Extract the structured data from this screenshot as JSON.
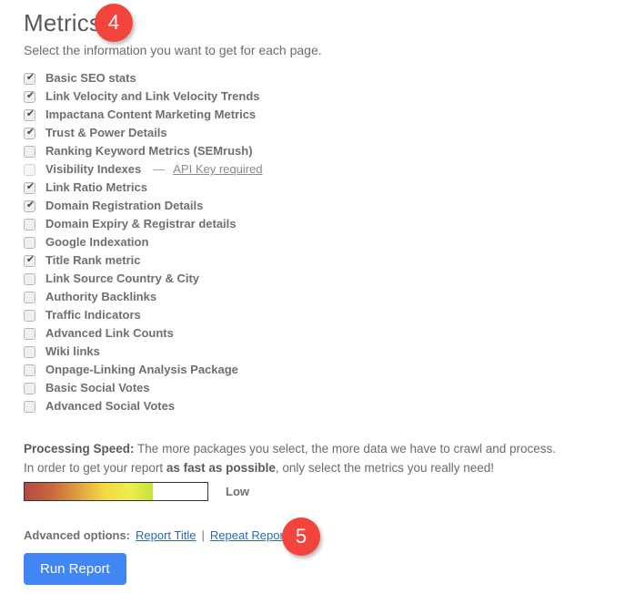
{
  "header": {
    "title": "Metrics",
    "step_badge": "4",
    "subtitle": "Select the information you want to get for each page."
  },
  "metrics": {
    "items": [
      {
        "label": "Basic SEO stats",
        "checked": true,
        "disabled": false
      },
      {
        "label": "Link Velocity and Link Velocity Trends",
        "checked": true,
        "disabled": false
      },
      {
        "label": "Impactana Content Marketing Metrics",
        "checked": true,
        "disabled": false
      },
      {
        "label": "Trust & Power Details",
        "checked": true,
        "disabled": false
      },
      {
        "label": "Ranking Keyword Metrics (SEMrush)",
        "checked": false,
        "disabled": false
      },
      {
        "label": "Visibility Indexes",
        "checked": false,
        "disabled": true,
        "note_dash": "—",
        "note_link": "API Key required"
      },
      {
        "label": "Link Ratio Metrics",
        "checked": true,
        "disabled": false
      },
      {
        "label": "Domain Registration Details",
        "checked": true,
        "disabled": false
      },
      {
        "label": "Domain Expiry & Registrar details",
        "checked": false,
        "disabled": false
      },
      {
        "label": "Google Indexation",
        "checked": false,
        "disabled": false
      },
      {
        "label": "Title Rank metric",
        "checked": true,
        "disabled": false
      },
      {
        "label": "Link Source Country & City",
        "checked": false,
        "disabled": false
      },
      {
        "label": "Authority Backlinks",
        "checked": false,
        "disabled": false
      },
      {
        "label": "Traffic Indicators",
        "checked": false,
        "disabled": false
      },
      {
        "label": "Advanced Link Counts",
        "checked": false,
        "disabled": false
      },
      {
        "label": "Wiki links",
        "checked": false,
        "disabled": false
      },
      {
        "label": "Onpage-Linking Analysis Package",
        "checked": false,
        "disabled": false
      },
      {
        "label": "Basic Social Votes",
        "checked": false,
        "disabled": false
      },
      {
        "label": "Advanced Social Votes",
        "checked": false,
        "disabled": false
      }
    ]
  },
  "processing_speed": {
    "line1_bold": "Processing Speed:",
    "line1_rest": " The more packages you select, the more data we have to crawl and process.",
    "line2_pre": "In order to get your report ",
    "line2_bold": "as fast as possible",
    "line2_post": ", only select the metrics you really need!",
    "gauge_fill_percent": "70%",
    "gauge_level_label": "Low",
    "gauge_colors": [
      "#b54a43",
      "#c9693f",
      "#e0a040",
      "#f4d845",
      "#eded4c",
      "#c8e33c"
    ]
  },
  "advanced": {
    "label": "Advanced options:",
    "link_report_title": "Report Title",
    "separator": "|",
    "link_repeat_report": "Repeat Report",
    "step_badge": "5"
  },
  "actions": {
    "run_report": "Run Report",
    "run_report_color": "#4285f4"
  }
}
